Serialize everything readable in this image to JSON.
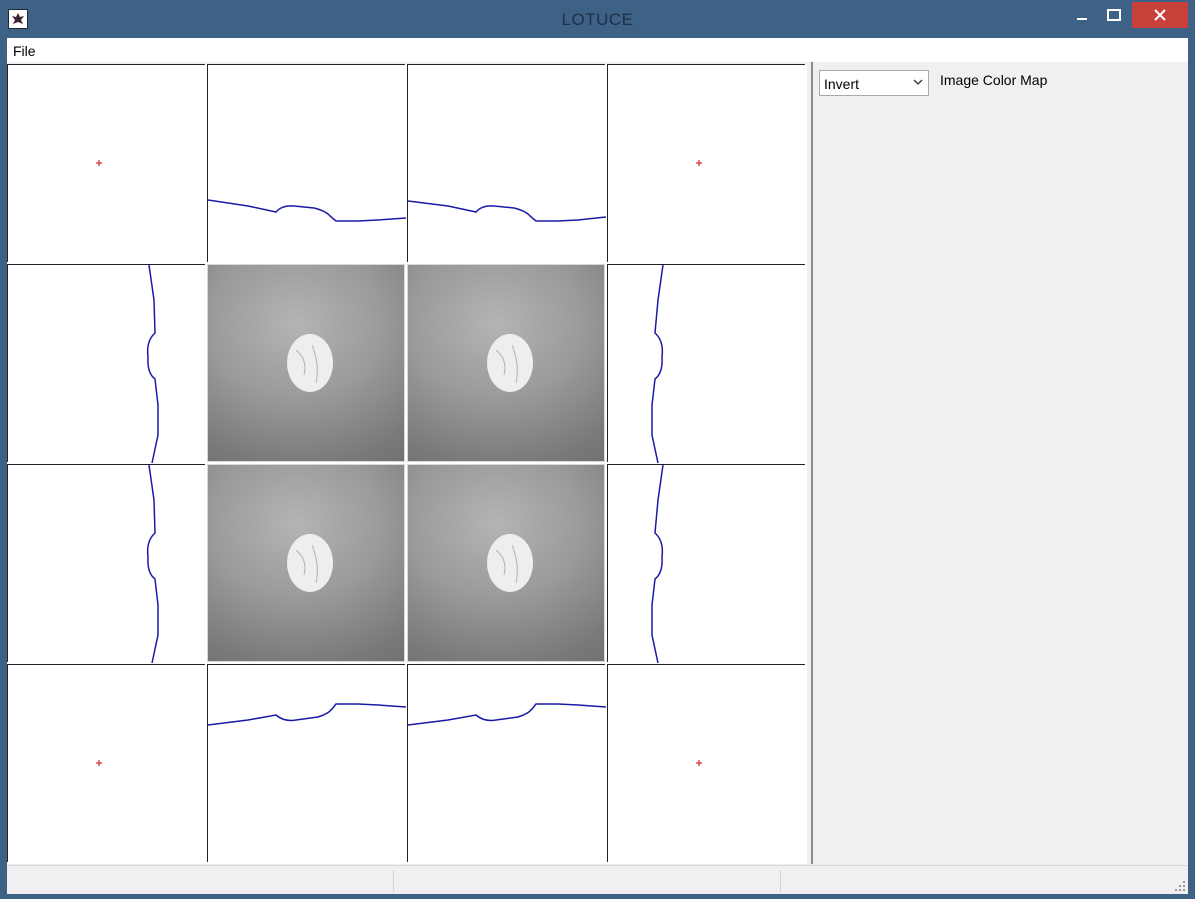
{
  "window": {
    "title": "LOTUCE",
    "icon": "lotus-app-icon",
    "controls": {
      "minimize": "minimize-icon",
      "maximize": "maximize-icon",
      "close": "close-icon"
    }
  },
  "menu": {
    "file": "File"
  },
  "side_panel": {
    "colormap_select": {
      "value": "Invert",
      "options": [
        "Invert"
      ]
    },
    "colormap_label": "Image Color Map"
  },
  "colors": {
    "profile_line": "#1a1aa8",
    "marker": "#d00000",
    "title_bar": "#3e6186",
    "close_button": "#c7413a"
  }
}
